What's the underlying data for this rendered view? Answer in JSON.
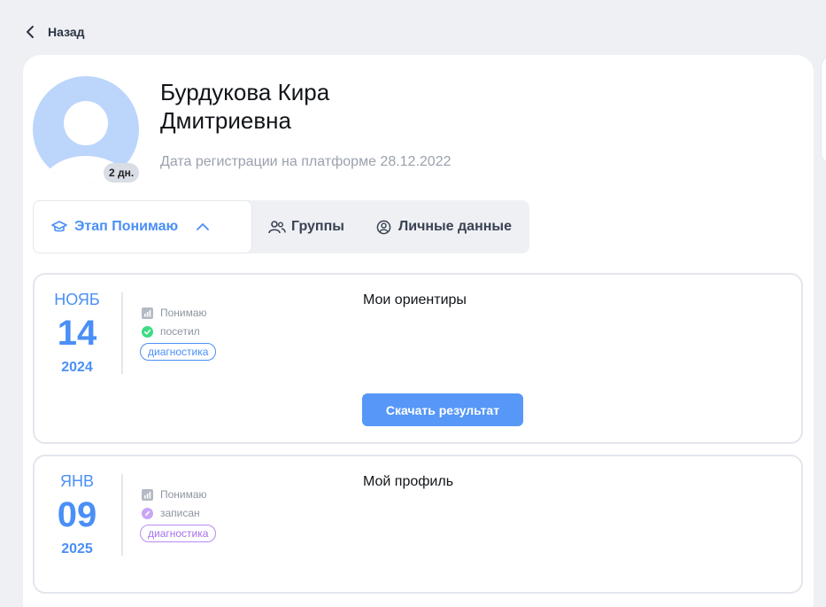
{
  "nav": {
    "back_label": "Назад"
  },
  "profile": {
    "last_name_first": "Бурдукова Кира",
    "patronymic": "Дмитриевна",
    "registration": "Дата регистрации на платформе 28.12.2022",
    "days_badge": "2 дн."
  },
  "tabs": [
    {
      "label": "Этап Понимаю",
      "icon": "graduation-cap-icon",
      "active": true
    },
    {
      "label": "Группы",
      "icon": "users-icon",
      "active": false
    },
    {
      "label": "Личные данные",
      "icon": "user-circle-icon",
      "active": false
    }
  ],
  "events": [
    {
      "month": "НОЯБ",
      "day": "14",
      "year": "2024",
      "stage": "Понимаю",
      "status": "посетил",
      "status_color": "#3ddc84",
      "tag": "диагностика",
      "title": "Мои ориентиры",
      "button": "Скачать результат"
    },
    {
      "month": "ЯНВ",
      "day": "09",
      "year": "2025",
      "stage": "Понимаю",
      "status": "записан",
      "status_color": "#c9a5f5",
      "tag": "диагностика",
      "title": "Мой профиль"
    }
  ],
  "colors": {
    "accent": "#4a8ff7",
    "background": "#eef0f4"
  }
}
